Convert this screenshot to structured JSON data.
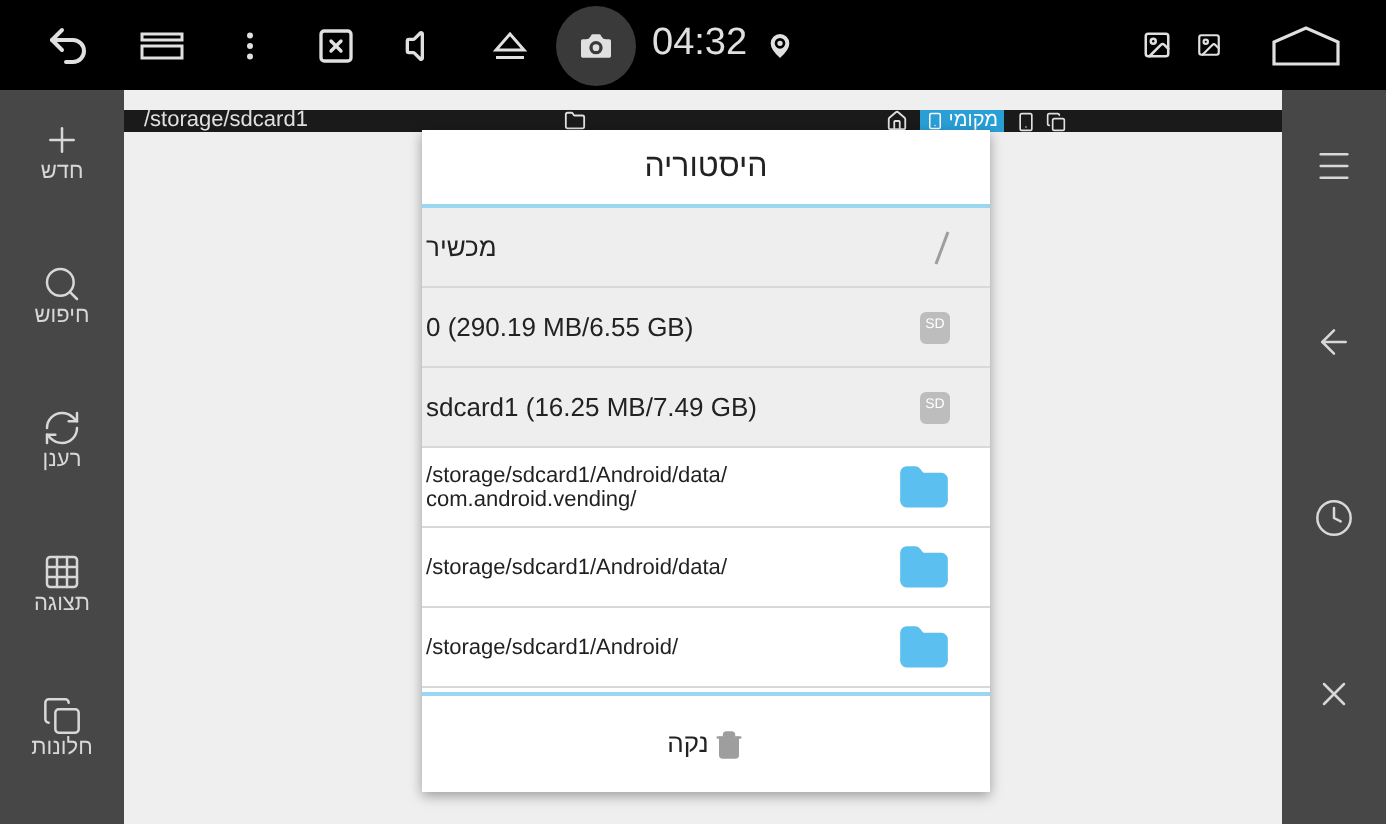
{
  "status_bar": {
    "time": "04:32"
  },
  "left_toolbar": [
    {
      "kind": "new",
      "label": "חדש"
    },
    {
      "kind": "search",
      "label": "חיפוש"
    },
    {
      "kind": "refresh",
      "label": "רענן"
    },
    {
      "kind": "view",
      "label": "תצוגה"
    },
    {
      "kind": "windows",
      "label": "חלונות"
    }
  ],
  "path_bar": {
    "path": "/storage/sdcard1",
    "tabs": [
      {
        "label": "מקומי",
        "selected": true
      }
    ]
  },
  "dialog": {
    "title": "היסטוריה",
    "rows": [
      {
        "kind": "root",
        "label": "מכשיר"
      },
      {
        "kind": "sd",
        "label": "0 (290.19 MB/6.55 GB)",
        "badge": "SD"
      },
      {
        "kind": "sd",
        "label": "sdcard1 (16.25 MB/7.49 GB)",
        "badge": "SD"
      },
      {
        "kind": "folder",
        "label": "/storage/sdcard1/Android/data/com.android.vending/"
      },
      {
        "kind": "folder",
        "label": "/storage/sdcard1/Android/data/"
      },
      {
        "kind": "folder",
        "label": "/storage/sdcard1/Android/"
      }
    ],
    "clear_button": "נקה"
  },
  "right_toolbar": [
    {
      "kind": "menu"
    },
    {
      "kind": "back"
    },
    {
      "kind": "history"
    },
    {
      "kind": "close"
    }
  ]
}
